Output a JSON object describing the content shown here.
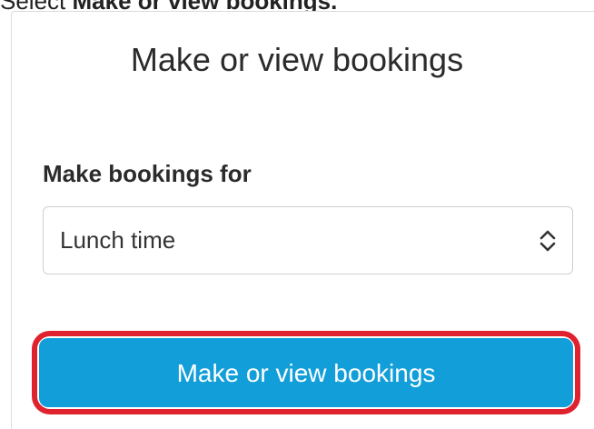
{
  "instruction": {
    "prefix": "Select ",
    "bold": "Make or view bookings."
  },
  "card": {
    "title": "Make or view bookings",
    "field_label": "Make bookings for",
    "select": {
      "selected_value": "Lunch time",
      "icon": "up-down-chevron-icon"
    },
    "button": {
      "label": "Make or view bookings"
    }
  },
  "colors": {
    "primary": "#129ed9",
    "highlight": "#e0222e"
  }
}
